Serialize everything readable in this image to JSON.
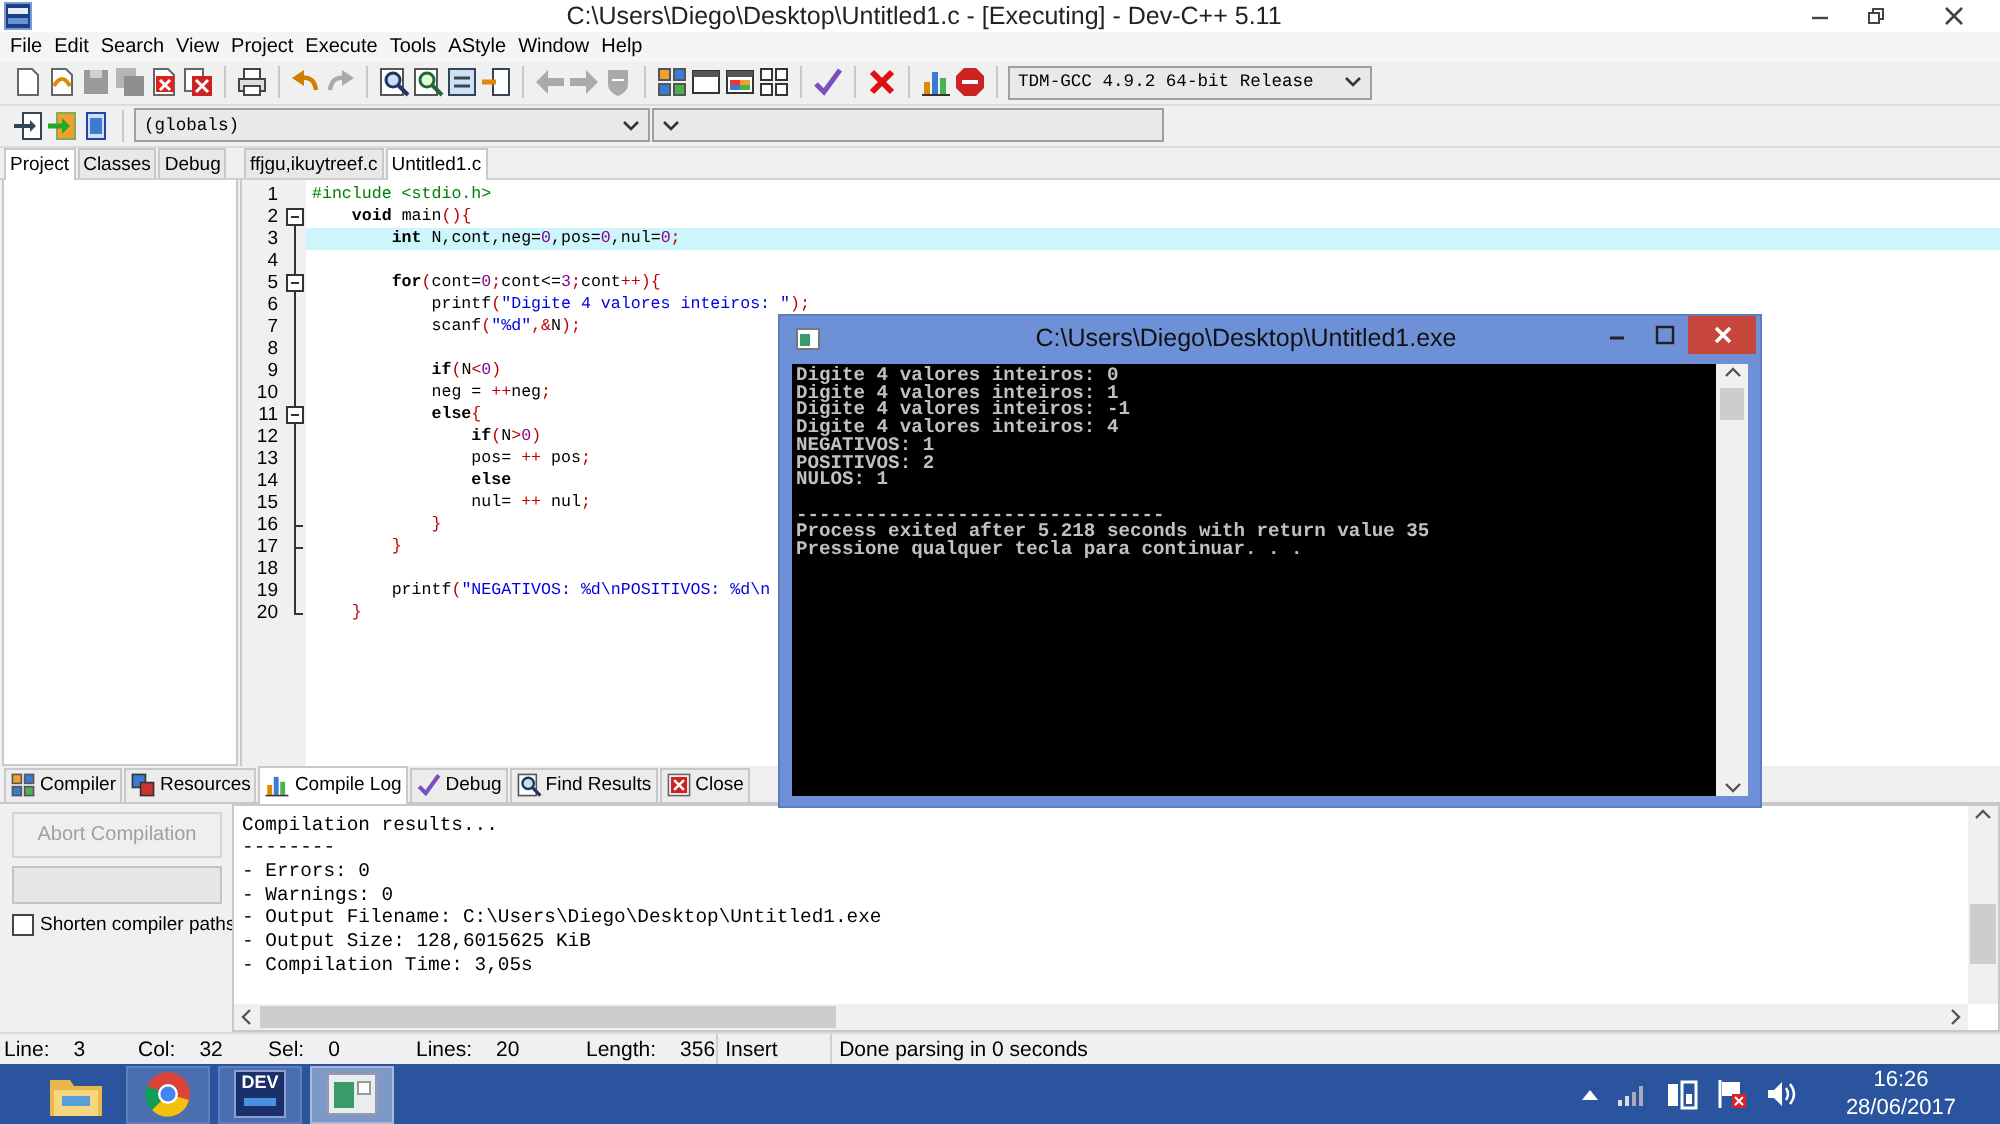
{
  "window": {
    "title": "C:\\Users\\Diego\\Desktop\\Untitled1.c - [Executing] - Dev-C++ 5.11"
  },
  "menu": [
    "File",
    "Edit",
    "Search",
    "View",
    "Project",
    "Execute",
    "Tools",
    "AStyle",
    "Window",
    "Help"
  ],
  "toolbar": {
    "compiler": "TDM-GCC 4.9.2 64-bit Release",
    "class_scope": "(globals)"
  },
  "side_tabs": [
    {
      "label": "Project",
      "selected": true
    },
    {
      "label": "Classes",
      "selected": false
    },
    {
      "label": "Debug",
      "selected": false
    }
  ],
  "editor_tabs": [
    {
      "label": "ffjgu,ikuytreef.c",
      "selected": false
    },
    {
      "label": "Untitled1.c",
      "selected": true
    }
  ],
  "editor": {
    "lines": [
      {
        "number": "1",
        "kind": "line",
        "current": false,
        "tokens": [
          {
            "text": "#include <stdio.h>",
            "kind": "preprocessor"
          }
        ]
      },
      {
        "number": "2",
        "kind": "fold-start",
        "current": false,
        "tokens": [
          {
            "text": "    void",
            "kind": "keyword"
          },
          {
            "text": " main",
            "kind": "plain"
          },
          {
            "text": "(){",
            "kind": "symbol"
          }
        ]
      },
      {
        "number": "3",
        "kind": "line",
        "current": true,
        "tokens": [
          {
            "text": "        int",
            "kind": "keyword"
          },
          {
            "text": " N,cont,neg=",
            "kind": "plain"
          },
          {
            "text": "0",
            "kind": "number"
          },
          {
            "text": ",pos=",
            "kind": "plain"
          },
          {
            "text": "0",
            "kind": "number"
          },
          {
            "text": ",nul=",
            "kind": "plain"
          },
          {
            "text": "0",
            "kind": "number"
          },
          {
            "text": ";",
            "kind": "symbol"
          }
        ]
      },
      {
        "number": "4",
        "kind": "line",
        "current": false
      },
      {
        "number": "5",
        "kind": "fold-start",
        "current": false,
        "tokens": [
          {
            "text": "        for",
            "kind": "keyword"
          },
          {
            "text": "(",
            "kind": "symbol"
          },
          {
            "text": "cont=",
            "kind": "plain"
          },
          {
            "text": "0",
            "kind": "number"
          },
          {
            "text": ";",
            "kind": "symbol"
          },
          {
            "text": "cont<=",
            "kind": "plain"
          },
          {
            "text": "3",
            "kind": "number"
          },
          {
            "text": ";",
            "kind": "symbol"
          },
          {
            "text": "cont",
            "kind": "plain"
          },
          {
            "text": "++){",
            "kind": "symbol"
          }
        ]
      },
      {
        "number": "6",
        "kind": "line",
        "current": false,
        "tokens": [
          {
            "text": "            printf",
            "kind": "plain"
          },
          {
            "text": "(",
            "kind": "symbol"
          },
          {
            "text": "\"Digite 4 valores inteiros: \"",
            "kind": "string"
          },
          {
            "text": ");",
            "kind": "symbol"
          }
        ]
      },
      {
        "number": "7",
        "kind": "line",
        "current": false,
        "tokens": [
          {
            "text": "            scanf",
            "kind": "plain"
          },
          {
            "text": "(",
            "kind": "symbol"
          },
          {
            "text": "\"%d\"",
            "kind": "string"
          },
          {
            "text": ",&",
            "kind": "symbol"
          },
          {
            "text": "N",
            "kind": "plain"
          },
          {
            "text": ");",
            "kind": "symbol"
          }
        ]
      },
      {
        "number": "8",
        "kind": "line",
        "current": false
      },
      {
        "number": "9",
        "kind": "line",
        "current": false,
        "tokens": [
          {
            "text": "            if",
            "kind": "keyword"
          },
          {
            "text": "(",
            "kind": "symbol"
          },
          {
            "text": "N",
            "kind": "plain"
          },
          {
            "text": "<",
            "kind": "symbol"
          },
          {
            "text": "0",
            "kind": "number"
          },
          {
            "text": ")",
            "kind": "symbol"
          }
        ]
      },
      {
        "number": "10",
        "kind": "line",
        "current": false,
        "tokens": [
          {
            "text": "            neg = ",
            "kind": "plain"
          },
          {
            "text": "++",
            "kind": "symbol"
          },
          {
            "text": "neg",
            "kind": "plain"
          },
          {
            "text": ";",
            "kind": "symbol"
          }
        ]
      },
      {
        "number": "11",
        "kind": "fold-start",
        "current": false,
        "tokens": [
          {
            "text": "            else",
            "kind": "keyword"
          },
          {
            "text": "{",
            "kind": "symbol"
          }
        ]
      },
      {
        "number": "12",
        "kind": "line",
        "current": false,
        "tokens": [
          {
            "text": "                if",
            "kind": "keyword"
          },
          {
            "text": "(",
            "kind": "symbol"
          },
          {
            "text": "N",
            "kind": "plain"
          },
          {
            "text": ">",
            "kind": "symbol"
          },
          {
            "text": "0",
            "kind": "number"
          },
          {
            "text": ")",
            "kind": "symbol"
          }
        ]
      },
      {
        "number": "13",
        "kind": "line",
        "current": false,
        "tokens": [
          {
            "text": "                pos= ",
            "kind": "plain"
          },
          {
            "text": "++",
            "kind": "symbol"
          },
          {
            "text": " pos",
            "kind": "plain"
          },
          {
            "text": ";",
            "kind": "symbol"
          }
        ]
      },
      {
        "number": "14",
        "kind": "line",
        "current": false,
        "tokens": [
          {
            "text": "                else",
            "kind": "keyword"
          }
        ]
      },
      {
        "number": "15",
        "kind": "line",
        "current": false,
        "tokens": [
          {
            "text": "                nul= ",
            "kind": "plain"
          },
          {
            "text": "++",
            "kind": "symbol"
          },
          {
            "text": " nul",
            "kind": "plain"
          },
          {
            "text": ";",
            "kind": "symbol"
          }
        ]
      },
      {
        "number": "16",
        "kind": "fold-end",
        "current": false,
        "tokens": [
          {
            "text": "            }",
            "kind": "symbol"
          }
        ]
      },
      {
        "number": "17",
        "kind": "fold-end",
        "current": false,
        "tokens": [
          {
            "text": "        }",
            "kind": "symbol"
          }
        ]
      },
      {
        "number": "18",
        "kind": "line",
        "current": false
      },
      {
        "number": "19",
        "kind": "line",
        "current": false,
        "tokens": [
          {
            "text": "        printf",
            "kind": "plain"
          },
          {
            "text": "(",
            "kind": "symbol"
          },
          {
            "text": "\"NEGATIVOS: %d\\nPOSITIVOS: %d\\n",
            "kind": "string"
          }
        ]
      },
      {
        "number": "20",
        "kind": "fold-end",
        "current": false,
        "tokens": [
          {
            "text": "    }",
            "kind": "symbol"
          }
        ]
      }
    ]
  },
  "console": {
    "title": "C:\\Users\\Diego\\Desktop\\Untitled1.exe",
    "blocks": [
      [
        "Digite 4 valores inteiros: 0",
        "Digite 4 valores inteiros: 1",
        "Digite 4 valores inteiros: -1",
        "Digite 4 valores inteiros: 4",
        "NEGATIVOS: 1",
        "POSITIVOS: 2",
        "NULOS: 1"
      ],
      [
        "--------------------------------",
        "Process exited after 5.218 seconds with return value 35",
        "Pressione qualquer tecla para continuar. . ."
      ]
    ]
  },
  "bottom_tabs": [
    {
      "label": "Compiler",
      "selected": false
    },
    {
      "label": "Resources",
      "selected": false
    },
    {
      "label": "Compile Log",
      "selected": true
    },
    {
      "label": "Debug",
      "selected": false
    },
    {
      "label": "Find Results",
      "selected": false
    },
    {
      "label": "Close",
      "selected": false
    }
  ],
  "compile_panel": {
    "abort_button": {
      "label": "Abort Compilation",
      "disabled": true
    },
    "progress": {
      "level": 0
    },
    "shorten_paths": {
      "label": "Shorten compiler paths",
      "checked": false
    },
    "log": [
      "Compilation results...",
      "--------",
      "- Errors: 0",
      "- Warnings: 0",
      "- Output Filename: C:\\Users\\Diego\\Desktop\\Untitled1.exe",
      "- Output Size: 128,6015625 KiB",
      "- Compilation Time: 3,05s"
    ]
  },
  "status_bar": {
    "fields": [
      {
        "label": "Line:",
        "value": "3"
      },
      {
        "label": "Col:",
        "value": "32"
      },
      {
        "label": "Sel:",
        "value": "0"
      },
      {
        "label": "Lines:",
        "value": "20"
      },
      {
        "label": "Length:",
        "value": "356"
      }
    ],
    "mode": "Insert",
    "message": "Done parsing in 0 seconds"
  },
  "taskbar": {
    "apps": [
      {
        "running": false,
        "selected": false
      },
      {
        "running": true,
        "selected": false
      },
      {
        "label": "DEV",
        "running": true,
        "selected": false
      },
      {
        "running": true,
        "selected": true
      }
    ],
    "time": "16:26",
    "date": "28/06/2017"
  }
}
